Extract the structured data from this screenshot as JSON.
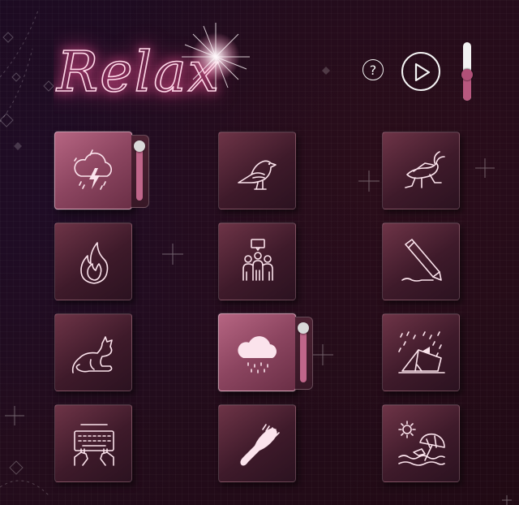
{
  "app": {
    "title": "Relax"
  },
  "header": {
    "help_label": "?"
  },
  "master_volume": {
    "level": 0.45
  },
  "sounds": [
    {
      "name": "thunderstorm",
      "active": true,
      "volume": 1.0
    },
    {
      "name": "bird",
      "active": false
    },
    {
      "name": "cricket",
      "active": false
    },
    {
      "name": "fire",
      "active": false
    },
    {
      "name": "crowd",
      "active": false
    },
    {
      "name": "writing",
      "active": false
    },
    {
      "name": "cat",
      "active": false
    },
    {
      "name": "rain",
      "active": true,
      "volume": 1.0
    },
    {
      "name": "tent-rain",
      "active": false
    },
    {
      "name": "keyboard",
      "active": false
    },
    {
      "name": "hairbrush",
      "active": false
    },
    {
      "name": "beach",
      "active": false
    }
  ],
  "colors": {
    "accent": "#c0668a",
    "neon": "#ffd7e8",
    "tile_active": "#b66582",
    "tile": "#4a2032"
  }
}
